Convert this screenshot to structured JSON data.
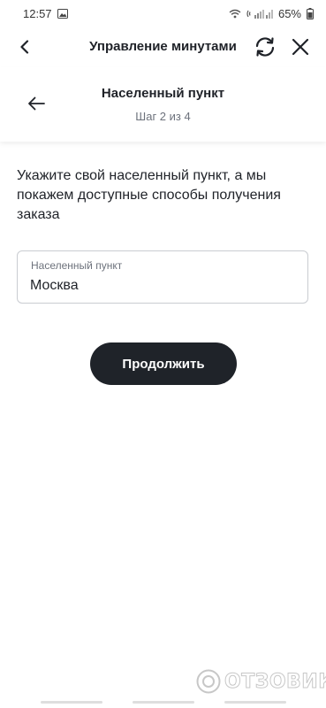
{
  "status_bar": {
    "time": "12:57",
    "battery": "65%",
    "icons": [
      "image-icon",
      "wifi-icon",
      "signal-icon",
      "battery-icon"
    ]
  },
  "app_header": {
    "title": "Управление минутами",
    "icons": {
      "back": "chevron-left-icon",
      "refresh": "refresh-icon",
      "close": "close-icon"
    }
  },
  "step": {
    "title": "Населенный пункт",
    "subtitle": "Шаг 2 из 4",
    "back_icon": "arrow-left-icon"
  },
  "main": {
    "instructions": "Укажите свой населенный пункт, а мы покажем доступные способы получения заказа",
    "field": {
      "label": "Населенный пункт",
      "value": "Москва"
    },
    "continue_label": "Продолжить"
  },
  "watermark": {
    "text": "ОТЗОВИК"
  },
  "colors": {
    "button_bg": "#1f2329",
    "button_text": "#ffffff",
    "text_primary": "#1f2228",
    "text_secondary": "#6d727c",
    "field_border": "#c9ccd1"
  }
}
